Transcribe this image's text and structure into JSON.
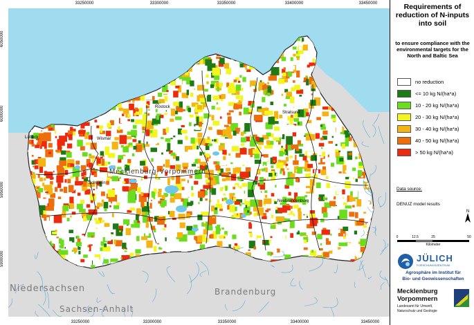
{
  "legend": {
    "title": "Requirements of reduction of N-inputs into soil",
    "subtitle": "to ensure compliance with the environmental targets for the North and Baltic Sea",
    "items": [
      {
        "label": "no reduction",
        "color": "#ffffff"
      },
      {
        "label": "<= 10 kg N/(ha*a)",
        "color": "#1e7a14"
      },
      {
        "label": "10 - 20 kg N/(ha*a)",
        "color": "#6bdc1e"
      },
      {
        "label": "20 - 30 kg N/(ha*a)",
        "color": "#f3f51e"
      },
      {
        "label": "30 - 40 kg N/(ha*a)",
        "color": "#f5b414"
      },
      {
        "label": "40 - 50 kg N/(ha*a)",
        "color": "#ec6e0c"
      },
      {
        "label": "> 50 kg N/(ha*a)",
        "color": "#ec2a0e"
      }
    ],
    "data_source_label": "Data source:",
    "data_source": "DENUZ model results"
  },
  "scalebar": {
    "ticks": [
      "0",
      "12.5",
      "25",
      "50"
    ],
    "unit": "Kilometer"
  },
  "logos": {
    "juelich_name": "JÜLICH",
    "juelich_sub": "FORSCHUNGSZENTRUM",
    "juelich_line1": "Agrosphäre im Institut für",
    "juelich_line2": "Bio- und Geowissenschaften",
    "mv_line1": "Mecklenburg",
    "mv_line2": "Vorpommern",
    "mv_line3": "Landesamt für Umwelt,",
    "mv_line4": "Naturschutz und Geologie"
  },
  "map": {
    "x_ticks": [
      "33250000",
      "33300000",
      "33350000",
      "33400000",
      "33450000"
    ],
    "y_ticks": [
      "6050000",
      "6000000",
      "5950000",
      "5900000"
    ],
    "region_label": "Mecklenburg-Vorpommern",
    "neighbors": [
      "Niedersachsen",
      "Sachsen-Anhalt",
      "Brandenburg"
    ],
    "cities": [
      "Rostock",
      "Stralsund",
      "Lübeck",
      "Wismar",
      "Schwerin",
      "Neubrandenburg"
    ],
    "colors": {
      "sea": "#9fdcf0",
      "land": "#dcdcdc",
      "lakes": "#6fc7ea"
    }
  }
}
